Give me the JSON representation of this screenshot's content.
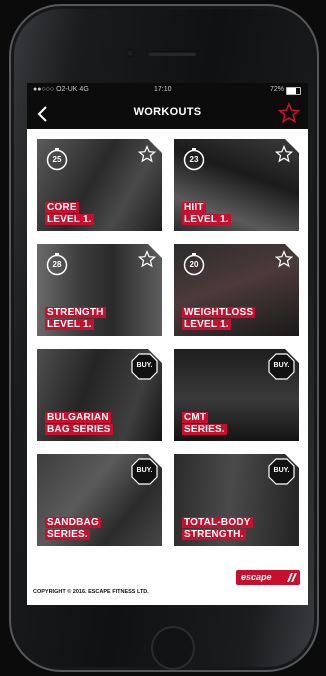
{
  "status": {
    "carrier": "●●○○○ O2-UK  4G",
    "time": "17:10",
    "battery": "72%",
    "battery_level": 0.72
  },
  "header": {
    "title": "WORKOUTS",
    "back_icon": "chevron-left-icon",
    "favorite_icon": "star-outline-icon"
  },
  "colors": {
    "accent": "#c8102e",
    "topbar": "#0c0c0c"
  },
  "workouts": [
    {
      "line1": "CORE",
      "line2": "LEVEL 1.",
      "minutes": "25",
      "type": "timer"
    },
    {
      "line1": "HIIT",
      "line2": "LEVEL 1.",
      "minutes": "23",
      "type": "timer"
    },
    {
      "line1": "STRENGTH",
      "line2": "LEVEL 1.",
      "minutes": "28",
      "type": "timer"
    },
    {
      "line1": "WEIGHTLOSS",
      "line2": "LEVEL 1.",
      "minutes": "20",
      "type": "timer"
    },
    {
      "line1": "BULGARIAN",
      "line2": "BAG SERIES",
      "badge": "BUY.",
      "type": "buy"
    },
    {
      "line1": "CMT",
      "line2": "SERIES.",
      "badge": "BUY.",
      "type": "buy"
    },
    {
      "line1": "SANDBAG",
      "line2": "SERIES.",
      "badge": "BUY.",
      "type": "buy"
    },
    {
      "line1": "TOTAL-BODY",
      "line2": "STRENGTH.",
      "badge": "BUY.",
      "type": "buy"
    }
  ],
  "footer": {
    "copyright": "COPYRIGHT © 2016. ESCAPE FITNESS LTD.",
    "brand": "escape"
  }
}
